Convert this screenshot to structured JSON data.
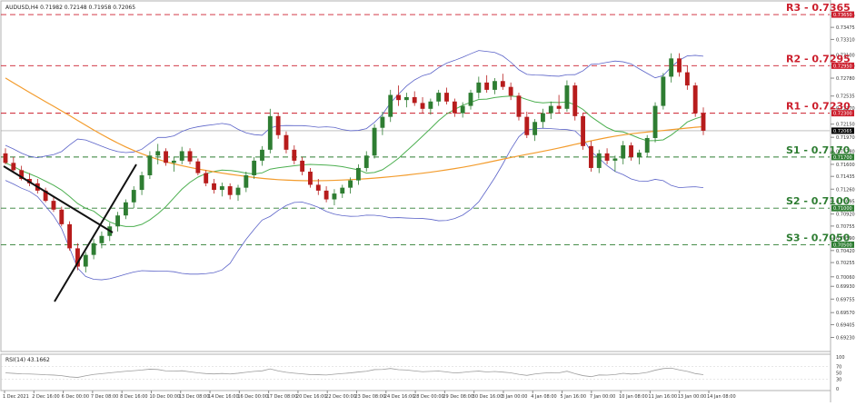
{
  "header": {
    "symbol_info": "AUDUSD,H4  0.71982 0.72148 0.71958 0.72065"
  },
  "levels": [
    {
      "label": "R3 - 0.7365",
      "value": 0.7365,
      "color": "#cc1f2d",
      "badge": "0.73650"
    },
    {
      "label": "R2 - 0.7295",
      "value": 0.7295,
      "color": "#cc1f2d",
      "badge": "0.72950"
    },
    {
      "label": "R1 - 0.7230",
      "value": 0.723,
      "color": "#cc1f2d",
      "badge": "0.72300"
    },
    {
      "label": "S1 - 0.7170",
      "value": 0.717,
      "color": "#2e7d32",
      "badge": "0.71700"
    },
    {
      "label": "S2 - 0.7100",
      "value": 0.71,
      "color": "#2e7d32",
      "badge": "0.71000"
    },
    {
      "label": "S3 - 0.7050",
      "value": 0.705,
      "color": "#2e7d32",
      "badge": "0.70500"
    }
  ],
  "current_price_badge": "0.72065",
  "price_axis_ticks": [
    "0.73640",
    "0.73475",
    "0.73310",
    "0.73100",
    "0.72950",
    "0.72780",
    "0.72535",
    "0.72370",
    "0.72150",
    "0.71970",
    "0.71780",
    "0.71600",
    "0.71435",
    "0.71260",
    "0.71095",
    "0.70920",
    "0.70755",
    "0.70590",
    "0.70420",
    "0.70255",
    "0.70060",
    "0.69930",
    "0.69755",
    "0.69570",
    "0.69405",
    "0.69230"
  ],
  "time_axis_labels": [
    "1 Dec 2021",
    "2 Dec 16:00",
    "6 Dec 00:00",
    "7 Dec 08:00",
    "8 Dec 16:00",
    "10 Dec 00:00",
    "13 Dec 08:00",
    "14 Dec 16:00",
    "16 Dec 00:00",
    "17 Dec 08:00",
    "20 Dec 16:00",
    "22 Dec 00:00",
    "23 Dec 08:00",
    "24 Dec 16:00",
    "28 Dec 00:00",
    "29 Dec 08:00",
    "30 Dec 16:00",
    "3 Jan 00:00",
    "4 Jan 08:00",
    "5 Jan 16:00",
    "7 Jan 00:00",
    "10 Jan 08:00",
    "11 Jan 16:00",
    "13 Jan 00:00",
    "14 Jan 08:00"
  ],
  "rsi": {
    "label": "RSI(14) 43.1662",
    "ticks": [
      "100",
      "70",
      "50",
      "30",
      "0"
    ]
  },
  "colors": {
    "bull": "#2e7d32",
    "bear": "#b71c1c",
    "bollinger": "#5b63c8",
    "ma_green": "#4caf50",
    "ma_orange": "#f39c2d",
    "trendline": "#111111",
    "rsi_line": "#9e9e9e"
  },
  "chart_data": {
    "type": "candlestick",
    "title": "AUDUSD,H4",
    "ylim": [
      0.6905,
      0.738
    ],
    "ylabel": "",
    "xlabel": "",
    "ohlc_approx": [
      [
        0.7175,
        0.7182,
        0.716,
        0.7162
      ],
      [
        0.7162,
        0.717,
        0.715,
        0.7152
      ],
      [
        0.7152,
        0.7158,
        0.7138,
        0.714
      ],
      [
        0.714,
        0.7148,
        0.713,
        0.7134
      ],
      [
        0.7134,
        0.714,
        0.712,
        0.7124
      ],
      [
        0.7124,
        0.7128,
        0.7108,
        0.711
      ],
      [
        0.711,
        0.7116,
        0.7095,
        0.7098
      ],
      [
        0.7098,
        0.7102,
        0.7075,
        0.7078
      ],
      [
        0.7078,
        0.7082,
        0.7042,
        0.7045
      ],
      [
        0.7045,
        0.7052,
        0.7015,
        0.702
      ],
      [
        0.702,
        0.704,
        0.7012,
        0.7036
      ],
      [
        0.7036,
        0.7058,
        0.703,
        0.7052
      ],
      [
        0.7052,
        0.7068,
        0.7045,
        0.7062
      ],
      [
        0.7062,
        0.708,
        0.7055,
        0.7075
      ],
      [
        0.7075,
        0.7095,
        0.7068,
        0.709
      ],
      [
        0.709,
        0.7112,
        0.7085,
        0.7108
      ],
      [
        0.7108,
        0.713,
        0.71,
        0.7125
      ],
      [
        0.7125,
        0.715,
        0.7118,
        0.7145
      ],
      [
        0.7145,
        0.7178,
        0.714,
        0.7172
      ],
      [
        0.7172,
        0.7188,
        0.716,
        0.7178
      ],
      [
        0.7178,
        0.7182,
        0.7158,
        0.7162
      ],
      [
        0.7162,
        0.717,
        0.715,
        0.7165
      ],
      [
        0.7165,
        0.7184,
        0.716,
        0.7178
      ],
      [
        0.7178,
        0.7182,
        0.716,
        0.7164
      ],
      [
        0.7164,
        0.7168,
        0.7145,
        0.7148
      ],
      [
        0.7148,
        0.7152,
        0.713,
        0.7134
      ],
      [
        0.7134,
        0.714,
        0.712,
        0.7125
      ],
      [
        0.7125,
        0.7135,
        0.7116,
        0.713
      ],
      [
        0.713,
        0.7134,
        0.7112,
        0.7118
      ],
      [
        0.7118,
        0.7132,
        0.711,
        0.7128
      ],
      [
        0.7128,
        0.715,
        0.7122,
        0.7145
      ],
      [
        0.7145,
        0.717,
        0.714,
        0.7165
      ],
      [
        0.7165,
        0.7185,
        0.7158,
        0.718
      ],
      [
        0.718,
        0.7236,
        0.7175,
        0.7226
      ],
      [
        0.7226,
        0.723,
        0.7195,
        0.72
      ],
      [
        0.72,
        0.7205,
        0.7175,
        0.718
      ],
      [
        0.718,
        0.7186,
        0.716,
        0.7165
      ],
      [
        0.7165,
        0.717,
        0.7145,
        0.715
      ],
      [
        0.715,
        0.7155,
        0.7128,
        0.7132
      ],
      [
        0.7132,
        0.714,
        0.7118,
        0.7124
      ],
      [
        0.7124,
        0.713,
        0.7108,
        0.7112
      ],
      [
        0.7112,
        0.7126,
        0.7104,
        0.712
      ],
      [
        0.712,
        0.7132,
        0.7114,
        0.7128
      ],
      [
        0.7128,
        0.7142,
        0.712,
        0.7138
      ],
      [
        0.7138,
        0.716,
        0.7132,
        0.7155
      ],
      [
        0.7155,
        0.7178,
        0.715,
        0.7172
      ],
      [
        0.7172,
        0.7215,
        0.7168,
        0.721
      ],
      [
        0.721,
        0.7232,
        0.72,
        0.7225
      ],
      [
        0.7225,
        0.7262,
        0.7218,
        0.7255
      ],
      [
        0.7255,
        0.7268,
        0.724,
        0.7248
      ],
      [
        0.7248,
        0.7258,
        0.7238,
        0.7252
      ],
      [
        0.7252,
        0.726,
        0.724,
        0.7244
      ],
      [
        0.7244,
        0.7252,
        0.723,
        0.7236
      ],
      [
        0.7236,
        0.725,
        0.7228,
        0.7246
      ],
      [
        0.7246,
        0.7262,
        0.724,
        0.7258
      ],
      [
        0.7258,
        0.7265,
        0.7242,
        0.7246
      ],
      [
        0.7246,
        0.725,
        0.7225,
        0.723
      ],
      [
        0.723,
        0.7245,
        0.7224,
        0.724
      ],
      [
        0.724,
        0.7262,
        0.7235,
        0.7258
      ],
      [
        0.7258,
        0.728,
        0.725,
        0.7272
      ],
      [
        0.7272,
        0.7282,
        0.7258,
        0.7262
      ],
      [
        0.7262,
        0.7278,
        0.7256,
        0.7274
      ],
      [
        0.7274,
        0.7284,
        0.7262,
        0.7266
      ],
      [
        0.7266,
        0.7272,
        0.7248,
        0.7254
      ],
      [
        0.7254,
        0.7258,
        0.722,
        0.7225
      ],
      [
        0.7225,
        0.7232,
        0.7196,
        0.72
      ],
      [
        0.72,
        0.7222,
        0.7192,
        0.7218
      ],
      [
        0.7218,
        0.7236,
        0.721,
        0.723
      ],
      [
        0.723,
        0.7246,
        0.7222,
        0.724
      ],
      [
        0.724,
        0.7255,
        0.723,
        0.7236
      ],
      [
        0.7236,
        0.7275,
        0.7232,
        0.7268
      ],
      [
        0.7268,
        0.7272,
        0.722,
        0.7226
      ],
      [
        0.7226,
        0.723,
        0.718,
        0.7185
      ],
      [
        0.7185,
        0.7192,
        0.715,
        0.7155
      ],
      [
        0.7155,
        0.718,
        0.7148,
        0.7175
      ],
      [
        0.7175,
        0.7182,
        0.716,
        0.7165
      ],
      [
        0.7165,
        0.7172,
        0.715,
        0.7168
      ],
      [
        0.7168,
        0.7192,
        0.716,
        0.7186
      ],
      [
        0.7186,
        0.719,
        0.7165,
        0.717
      ],
      [
        0.717,
        0.718,
        0.716,
        0.7176
      ],
      [
        0.7176,
        0.72,
        0.717,
        0.7196
      ],
      [
        0.7196,
        0.7245,
        0.719,
        0.724
      ],
      [
        0.724,
        0.7285,
        0.7235,
        0.728
      ],
      [
        0.728,
        0.7312,
        0.7272,
        0.7305
      ],
      [
        0.7305,
        0.7312,
        0.728,
        0.7286
      ],
      [
        0.7286,
        0.7295,
        0.7262,
        0.7268
      ],
      [
        0.7268,
        0.7272,
        0.7225,
        0.723
      ],
      [
        0.723,
        0.7238,
        0.72,
        0.7206
      ]
    ]
  }
}
